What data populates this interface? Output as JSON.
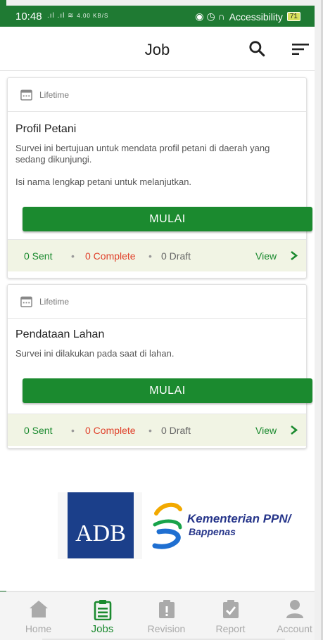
{
  "status_bar": {
    "time": "10:48",
    "signal": ".ıl .ıl",
    "net_speed": "4.00 KB/S",
    "accessibility": "Accessibility",
    "battery": "71"
  },
  "app_bar": {
    "title": "Job",
    "search_icon": "search-icon",
    "filter_icon": "filter-sort-icon"
  },
  "jobs": [
    {
      "period": "Lifetime",
      "title": "Profil Petani",
      "description": "Survei ini bertujuan untuk mendata profil petani di daerah yang sedang dikunjungi.",
      "description_2": "Isi nama lengkap petani untuk melanjutkan.",
      "button": "MULAI",
      "sent": "0 Sent",
      "complete": "0 Complete",
      "draft": "0 Draft",
      "view": "View"
    },
    {
      "period": "Lifetime",
      "title": "Pendataan Lahan",
      "description": "Survei ini dilakukan pada saat di lahan.",
      "button": "MULAI",
      "sent": "0 Sent",
      "complete": "0 Complete",
      "draft": "0 Draft",
      "view": "View"
    }
  ],
  "logos": {
    "adb": "ADB",
    "bappenas_line1": "Kementerian PPN/",
    "bappenas_line2": "Bappenas"
  },
  "bottom_nav": [
    {
      "label": "Home",
      "icon": "home-icon",
      "active": false
    },
    {
      "label": "Jobs",
      "icon": "clipboard-list-icon",
      "active": true
    },
    {
      "label": "Revision",
      "icon": "alert-clipboard-icon",
      "active": false
    },
    {
      "label": "Report",
      "icon": "check-clipboard-icon",
      "active": false
    },
    {
      "label": "Account",
      "icon": "person-icon",
      "active": false
    }
  ],
  "colors": {
    "primary": "#1b8a2f",
    "complete": "#e0412b",
    "footer_bg": "#f1f4e4",
    "inactive": "#aaaaaa"
  }
}
